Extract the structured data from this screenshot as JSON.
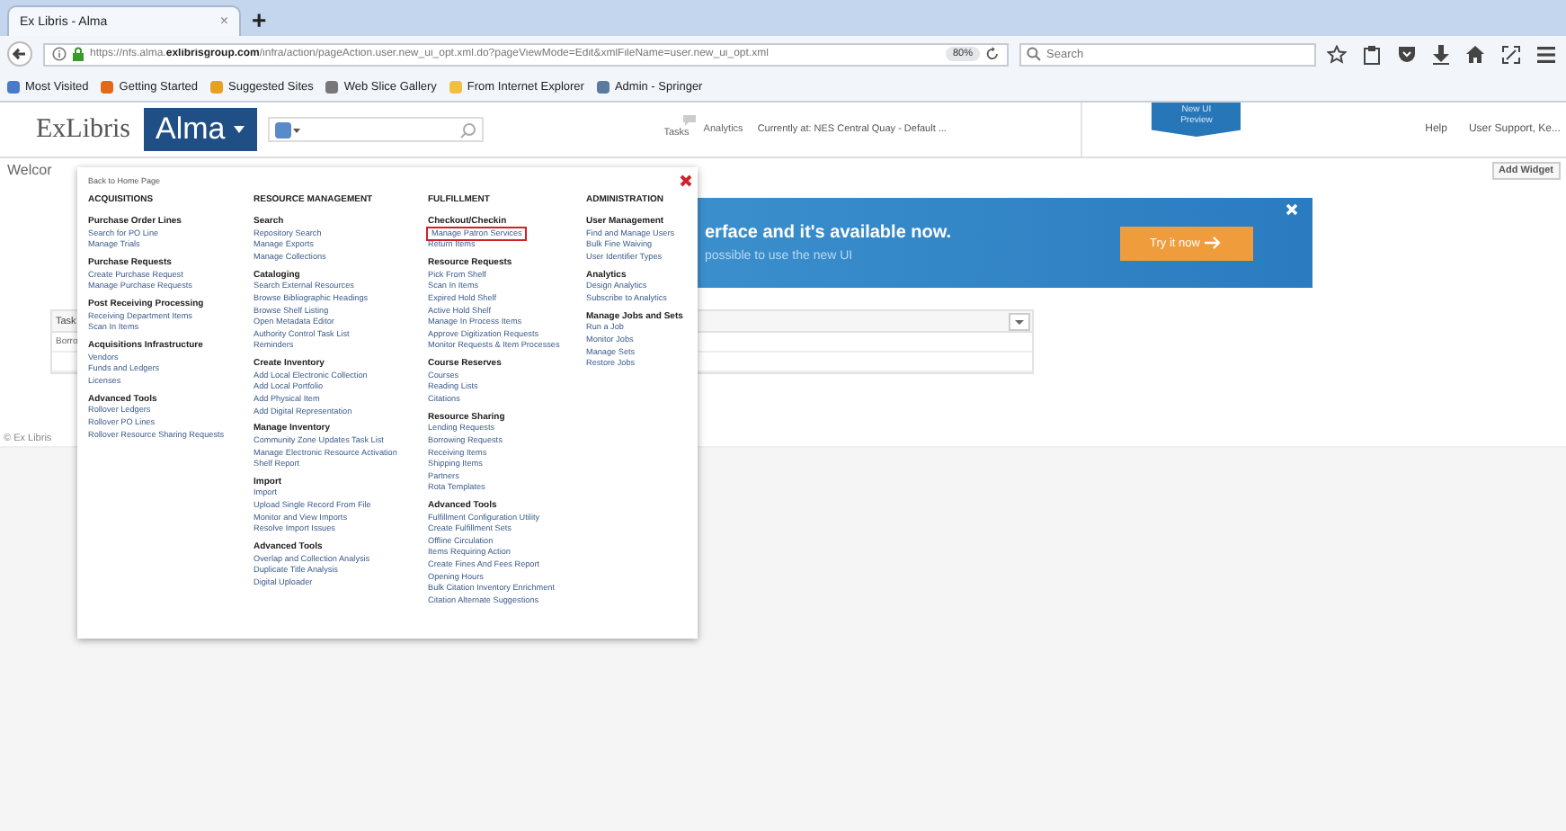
{
  "browser": {
    "tab": {
      "title": "Ex Libris - Alma",
      "close": "×"
    },
    "new_tab": "+",
    "url": {
      "prefix": "https://nfs.alma.",
      "domain": "exlibrisgroup.com",
      "path": "/infra/action/pageAction.user.new_ui_opt.xml.do?pageViewMode=Edit&xmlFileName=user.new_ui_opt.xml"
    },
    "zoom": "80%",
    "search": {
      "placeholder": "Search"
    },
    "bookmarks": [
      "Most Visited",
      "Getting Started",
      "Suggested Sites",
      "Web Slice Gallery",
      "From Internet Explorer",
      "Admin - Springer"
    ]
  },
  "header": {
    "logo": "ExLibris",
    "app_menu": "Alma",
    "links": [
      "Tasks",
      "Analytics"
    ],
    "location": "Currently at: NES Central Quay - Default ...",
    "preview": "New UI Preview",
    "help": "Help",
    "user": "User Support, Ke..."
  },
  "page": {
    "welcome": "Welcor",
    "add_widget": "Add Widget",
    "banner": {
      "headline": "erface and it's available now.",
      "subtext": "possible to use the new UI",
      "button": "Try it now"
    },
    "tasks": {
      "title": "Task",
      "row": "Borro"
    },
    "footer": "© Ex Libris"
  },
  "menu": {
    "back_link": "Back to Home Page",
    "columns": [
      {
        "title": "ACQUISITIONS",
        "groups": [
          {
            "heading": "Purchase Order Lines",
            "items": [
              {
                "label": "Search for PO Line",
                "highlighted": false
              },
              {
                "label": "Manage Trials",
                "highlighted": false
              }
            ]
          },
          {
            "heading": "Purchase Requests",
            "items": [
              {
                "label": "Create Purchase Request",
                "highlighted": false
              },
              {
                "label": "Manage Purchase Requests",
                "highlighted": false
              }
            ]
          },
          {
            "heading": "Post Receiving Processing",
            "items": [
              {
                "label": "Receiving Department Items",
                "highlighted": false
              },
              {
                "label": "Scan In Items",
                "highlighted": false
              }
            ]
          },
          {
            "heading": "Acquisitions Infrastructure",
            "items": [
              {
                "label": "Vendors",
                "highlighted": false
              },
              {
                "label": "Funds and Ledgers",
                "highlighted": false
              },
              {
                "label": "Licenses",
                "highlighted": false
              }
            ]
          },
          {
            "heading": "Advanced Tools",
            "items": [
              {
                "label": "Rollover Ledgers",
                "highlighted": false
              },
              {
                "label": "Rollover PO Lines",
                "highlighted": false
              },
              {
                "label": "Rollover Resource Sharing Requests",
                "highlighted": false
              }
            ]
          }
        ]
      },
      {
        "title": "RESOURCE MANAGEMENT",
        "groups": [
          {
            "heading": "Search",
            "items": [
              {
                "label": "Repository Search",
                "highlighted": false
              },
              {
                "label": "Manage Exports",
                "highlighted": false
              },
              {
                "label": "Manage Collections",
                "highlighted": false
              }
            ]
          },
          {
            "heading": "Cataloging",
            "items": [
              {
                "label": "Search External Resources",
                "highlighted": false
              },
              {
                "label": "Browse Bibliographic Headings",
                "highlighted": false
              },
              {
                "label": "Browse Shelf Listing",
                "highlighted": false
              },
              {
                "label": "Open Metadata Editor",
                "highlighted": false
              },
              {
                "label": "Authority Control Task List",
                "highlighted": false
              },
              {
                "label": "Reminders",
                "highlighted": false
              }
            ]
          },
          {
            "heading": "Create Inventory",
            "items": [
              {
                "label": "Add Local Electronic Collection",
                "highlighted": false
              },
              {
                "label": "Add Local Portfolio",
                "highlighted": false
              },
              {
                "label": "Add Physical Item",
                "highlighted": false
              },
              {
                "label": "Add Digital Representation",
                "highlighted": false
              }
            ]
          },
          {
            "heading": "Manage Inventory",
            "items": [
              {
                "label": "Community Zone Updates Task List",
                "highlighted": false
              },
              {
                "label": "Manage Electronic Resource Activation",
                "highlighted": false
              },
              {
                "label": "Shelf Report",
                "highlighted": false
              }
            ]
          },
          {
            "heading": "Import",
            "items": [
              {
                "label": "Import",
                "highlighted": false
              },
              {
                "label": "Upload Single Record From File",
                "highlighted": false
              },
              {
                "label": "Monitor and View Imports",
                "highlighted": false
              },
              {
                "label": "Resolve Import Issues",
                "highlighted": false
              }
            ]
          },
          {
            "heading": "Advanced Tools",
            "items": [
              {
                "label": "Overlap and Collection Analysis",
                "highlighted": false
              },
              {
                "label": "Duplicate Title Analysis",
                "highlighted": false
              },
              {
                "label": "Digital Uploader",
                "highlighted": false
              }
            ]
          }
        ]
      },
      {
        "title": "FULFILLMENT",
        "groups": [
          {
            "heading": "Checkout/Checkin",
            "items": [
              {
                "label": "Manage Patron Services",
                "highlighted": true
              },
              {
                "label": "Return Items",
                "highlighted": false
              }
            ]
          },
          {
            "heading": "Resource Requests",
            "items": [
              {
                "label": "Pick From Shelf",
                "highlighted": false
              },
              {
                "label": "Scan In Items",
                "highlighted": false
              },
              {
                "label": "Expired Hold Shelf",
                "highlighted": false
              },
              {
                "label": "Active Hold Shelf",
                "highlighted": false
              },
              {
                "label": "Manage In Process Items",
                "highlighted": false
              },
              {
                "label": "Approve Digitization Requests",
                "highlighted": false
              },
              {
                "label": "Monitor Requests & Item Processes",
                "highlighted": false
              }
            ]
          },
          {
            "heading": "Course Reserves",
            "items": [
              {
                "label": "Courses",
                "highlighted": false
              },
              {
                "label": "Reading Lists",
                "highlighted": false
              },
              {
                "label": "Citations",
                "highlighted": false
              }
            ]
          },
          {
            "heading": "Resource Sharing",
            "items": [
              {
                "label": "Lending Requests",
                "highlighted": false
              },
              {
                "label": "Borrowing Requests",
                "highlighted": false
              },
              {
                "label": "Receiving Items",
                "highlighted": false
              },
              {
                "label": "Shipping Items",
                "highlighted": false
              },
              {
                "label": "Partners",
                "highlighted": false
              },
              {
                "label": "Rota Templates",
                "highlighted": false
              }
            ]
          },
          {
            "heading": "Advanced Tools",
            "items": [
              {
                "label": "Fulfillment Configuration Utility",
                "highlighted": false
              },
              {
                "label": "Create Fulfillment Sets",
                "highlighted": false
              },
              {
                "label": "Offline Circulation",
                "highlighted": false
              },
              {
                "label": "Items Requiring Action",
                "highlighted": false
              },
              {
                "label": "Create Fines And Fees Report",
                "highlighted": false
              },
              {
                "label": "Opening Hours",
                "highlighted": false
              },
              {
                "label": "Bulk Citation Inventory Enrichment",
                "highlighted": false
              },
              {
                "label": "Citation Alternate Suggestions",
                "highlighted": false
              }
            ]
          }
        ]
      },
      {
        "title": "ADMINISTRATION",
        "groups": [
          {
            "heading": "User Management",
            "items": [
              {
                "label": "Find and Manage Users",
                "highlighted": false
              },
              {
                "label": "Bulk Fine Waiving",
                "highlighted": false
              },
              {
                "label": "User Identifier Types",
                "highlighted": false
              }
            ]
          },
          {
            "heading": "Analytics",
            "items": [
              {
                "label": "Design Analytics",
                "highlighted": false
              },
              {
                "label": "Subscribe to Analytics",
                "highlighted": false
              }
            ]
          },
          {
            "heading": "Manage Jobs and Sets",
            "items": [
              {
                "label": "Run a Job",
                "highlighted": false
              },
              {
                "label": "Monitor Jobs",
                "highlighted": false
              },
              {
                "label": "Manage Sets",
                "highlighted": false
              },
              {
                "label": "Restore Jobs",
                "highlighted": false
              }
            ]
          }
        ]
      }
    ]
  }
}
